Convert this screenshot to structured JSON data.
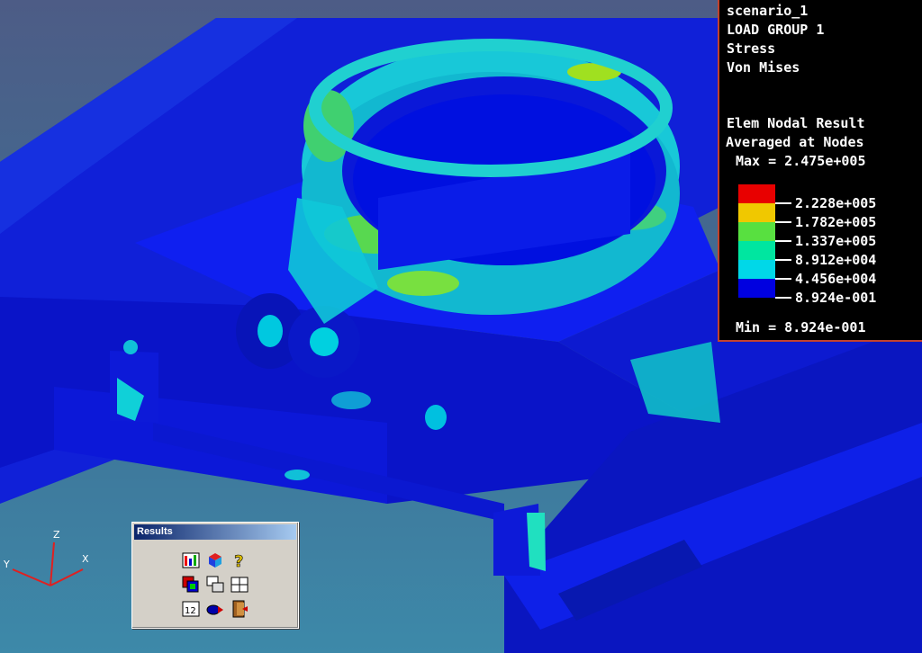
{
  "legend": {
    "header": [
      "scenario_1",
      "LOAD GROUP 1",
      "Stress",
      "Von Mises"
    ],
    "result_type": "Elem Nodal Result",
    "averaging": "Averaged at Nodes",
    "max_text": "Max = 2.475e+005",
    "min_text": "Min = 8.924e-001",
    "colors": [
      "#e80000",
      "#f0c800",
      "#58e040",
      "#00e6a0",
      "#00d8e8",
      "#0000e0"
    ],
    "levels": [
      "2.228e+005",
      "1.782e+005",
      "1.337e+005",
      "8.912e+004",
      "4.456e+004",
      "8.924e-001"
    ]
  },
  "triad": {
    "z": "Z",
    "y": "Y",
    "x": "X"
  },
  "results_toolbar": {
    "title": "Results",
    "tools": [
      "results-display-icon",
      "model-cube-icon",
      "help-icon",
      "animate-icon",
      "copy-view-icon",
      "table-icon",
      "numeric-values-icon",
      "export-icon",
      "exit-icon"
    ]
  },
  "colors": {
    "model_blue": "#0a14e6",
    "ring_cyan": "#10c8d8",
    "panel_border": "#c2422c"
  }
}
